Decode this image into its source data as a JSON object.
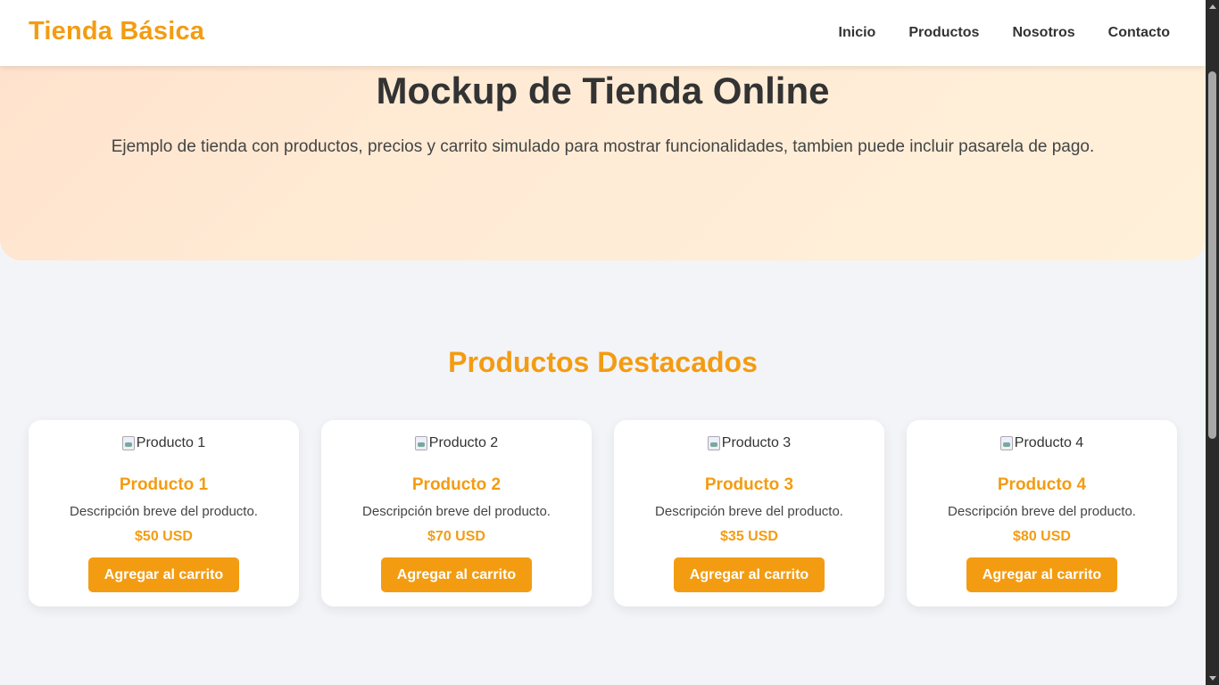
{
  "header": {
    "brand": "Tienda Básica",
    "nav": [
      "Inicio",
      "Productos",
      "Nosotros",
      "Contacto"
    ]
  },
  "hero": {
    "title": "Mockup de Tienda Online",
    "subtitle": "Ejemplo de tienda con productos, precios y carrito simulado para mostrar funcionalidades, tambien puede incluir pasarela de pago."
  },
  "products_section": {
    "title": "Productos Destacados",
    "items": [
      {
        "image_alt": "Producto 1",
        "name": "Producto 1",
        "description": "Descripción breve del producto.",
        "price": "$50 USD",
        "button": "Agregar al carrito"
      },
      {
        "image_alt": "Producto 2",
        "name": "Producto 2",
        "description": "Descripción breve del producto.",
        "price": "$70 USD",
        "button": "Agregar al carrito"
      },
      {
        "image_alt": "Producto 3",
        "name": "Producto 3",
        "description": "Descripción breve del producto.",
        "price": "$35 USD",
        "button": "Agregar al carrito"
      },
      {
        "image_alt": "Producto 4",
        "name": "Producto 4",
        "description": "Descripción breve del producto.",
        "price": "$80 USD",
        "button": "Agregar al carrito"
      }
    ]
  },
  "colors": {
    "accent": "#f39c12",
    "page_background": "#f3f4f8",
    "hero_gradient_start": "#ffe1cc",
    "hero_gradient_end": "#fff0da"
  }
}
